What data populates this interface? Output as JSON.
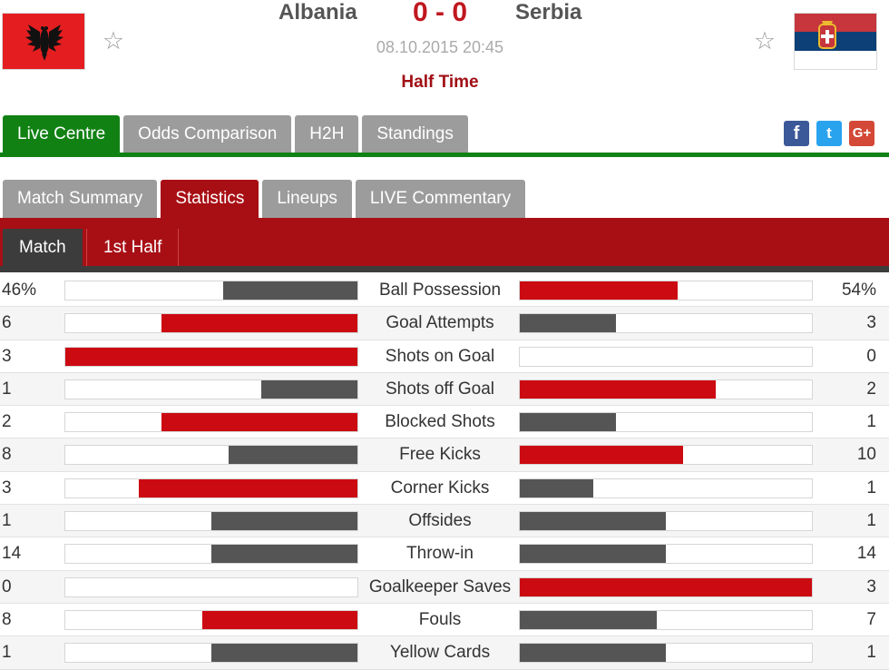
{
  "match": {
    "home_team": "Albania",
    "away_team": "Serbia",
    "score": "0 - 0",
    "date_time": "08.10.2015 20:45",
    "status": "Half Time"
  },
  "colors": {
    "leader": "#cc0a12",
    "trailer": "#555555",
    "main_tab_active": "#118114",
    "sub_tab_active": "#a80f15"
  },
  "main_tabs": [
    {
      "label": "Live Centre",
      "active": true
    },
    {
      "label": "Odds Comparison",
      "active": false
    },
    {
      "label": "H2H",
      "active": false
    },
    {
      "label": "Standings",
      "active": false
    }
  ],
  "social": {
    "facebook": "f",
    "twitter": "t",
    "google_plus": "G+"
  },
  "sub_tabs": [
    {
      "label": "Match Summary",
      "active": false
    },
    {
      "label": "Statistics",
      "active": true
    },
    {
      "label": "Lineups",
      "active": false
    },
    {
      "label": "LIVE Commentary",
      "active": false
    }
  ],
  "period_tabs": [
    {
      "label": "Match",
      "active": true
    },
    {
      "label": "1st Half",
      "active": false
    }
  ],
  "stats": [
    {
      "label": "Ball Possession",
      "home": "46%",
      "away": "54%",
      "home_share": 0.46,
      "away_share": 0.54
    },
    {
      "label": "Goal Attempts",
      "home": "6",
      "away": "3",
      "home_share": 0.67,
      "away_share": 0.33
    },
    {
      "label": "Shots on Goal",
      "home": "3",
      "away": "0",
      "home_share": 1.0,
      "away_share": 0.0
    },
    {
      "label": "Shots off Goal",
      "home": "1",
      "away": "2",
      "home_share": 0.33,
      "away_share": 0.67
    },
    {
      "label": "Blocked Shots",
      "home": "2",
      "away": "1",
      "home_share": 0.67,
      "away_share": 0.33
    },
    {
      "label": "Free Kicks",
      "home": "8",
      "away": "10",
      "home_share": 0.44,
      "away_share": 0.56
    },
    {
      "label": "Corner Kicks",
      "home": "3",
      "away": "1",
      "home_share": 0.75,
      "away_share": 0.25
    },
    {
      "label": "Offsides",
      "home": "1",
      "away": "1",
      "home_share": 0.5,
      "away_share": 0.5
    },
    {
      "label": "Throw-in",
      "home": "14",
      "away": "14",
      "home_share": 0.5,
      "away_share": 0.5
    },
    {
      "label": "Goalkeeper Saves",
      "home": "0",
      "away": "3",
      "home_share": 0.0,
      "away_share": 1.0
    },
    {
      "label": "Fouls",
      "home": "8",
      "away": "7",
      "home_share": 0.53,
      "away_share": 0.47
    },
    {
      "label": "Yellow Cards",
      "home": "1",
      "away": "1",
      "home_share": 0.5,
      "away_share": 0.5
    }
  ]
}
